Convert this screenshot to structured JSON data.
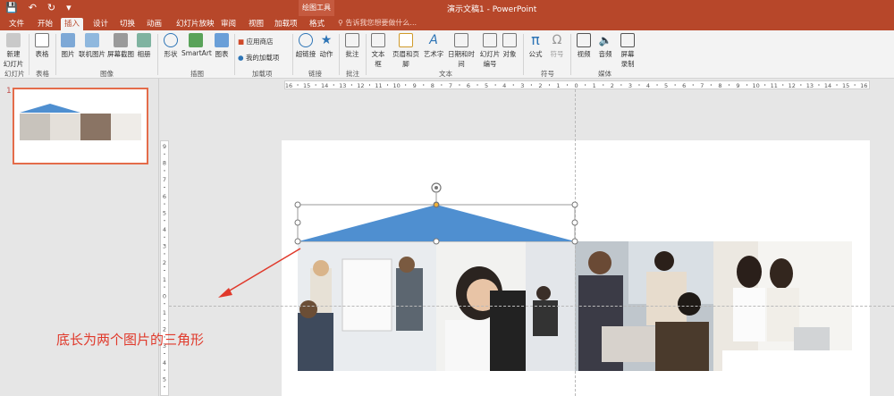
{
  "titlebar": {
    "tools_label": "绘图工具",
    "window_title": "演示文稿1 - PowerPoint",
    "qat_icons": [
      "save-icon",
      "undo-icon",
      "redo-icon",
      "customize-icon"
    ]
  },
  "tabs": [
    "文件",
    "开始",
    "插入",
    "设计",
    "切换",
    "动画",
    "幻灯片放映",
    "审阅",
    "视图",
    "加载项",
    "格式"
  ],
  "active_tab": "插入",
  "search": {
    "placeholder": "告诉我您想要做什么..."
  },
  "ribbon": {
    "buttons": [
      "新建\n幻灯片",
      "表格",
      "图片",
      "联机图片",
      "屏幕截图",
      "相册",
      "形状",
      "SmartArt",
      "图表",
      "应用商店",
      "我的加载项",
      "超链接",
      "动作",
      "批注",
      "文本框",
      "页眉和页脚",
      "艺术字",
      "日期和时间",
      "幻灯片\n编号",
      "对象",
      "公式",
      "符号",
      "视频",
      "音频",
      "屏幕\n录制"
    ],
    "groups": [
      "幻灯片",
      "表格",
      "图像",
      "插图",
      "加载项",
      "链接",
      "批注",
      "文本",
      "符号",
      "媒体"
    ]
  },
  "slide_panel": {
    "slide_number": "1"
  },
  "rulers": {
    "h_ticks": [
      "16",
      "15",
      "14",
      "13",
      "12",
      "11",
      "10",
      "9",
      "8",
      "7",
      "6",
      "5",
      "4",
      "3",
      "2",
      "1",
      "0",
      "1",
      "2",
      "3",
      "4",
      "5",
      "6",
      "7",
      "8",
      "9",
      "10",
      "11",
      "12",
      "13",
      "14",
      "15",
      "16"
    ],
    "v_ticks": [
      "9",
      "8",
      "7",
      "6",
      "5",
      "4",
      "3",
      "2",
      "1",
      "0",
      "1",
      "2",
      "3",
      "4",
      "5"
    ]
  },
  "annotation": {
    "text": "底长为两个图片的三角形"
  },
  "colors": {
    "accent": "#b7472a",
    "triangle": "#4f8fd0",
    "arrow": "#e0392b",
    "thumb_border": "#e46c4a"
  }
}
